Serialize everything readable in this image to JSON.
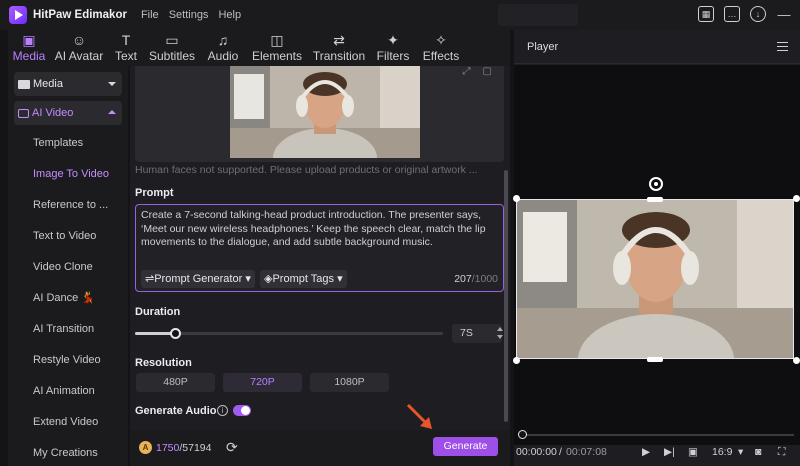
{
  "titlebar": {
    "app_name": "HitPaw Edimakor",
    "menus": [
      "File",
      "Settings",
      "Help"
    ]
  },
  "toolbar": {
    "tools": [
      {
        "label": "Media",
        "icon": "media-icon"
      },
      {
        "label": "AI Avatar",
        "icon": "avatar-icon"
      },
      {
        "label": "Text",
        "icon": "text-icon"
      },
      {
        "label": "Subtitles",
        "icon": "subtitles-icon"
      },
      {
        "label": "Audio",
        "icon": "audio-icon"
      },
      {
        "label": "Elements",
        "icon": "elements-icon"
      },
      {
        "label": "Transition",
        "icon": "transition-icon"
      },
      {
        "label": "Filters",
        "icon": "filters-icon"
      },
      {
        "label": "Effects",
        "icon": "effects-icon"
      }
    ],
    "active": "Media"
  },
  "sidebar": {
    "media_label": "Media",
    "ai_video_label": "AI Video",
    "items": [
      {
        "label": "Templates"
      },
      {
        "label": "Image To Video"
      },
      {
        "label": "Reference to ..."
      },
      {
        "label": "Text to Video"
      },
      {
        "label": "Video Clone"
      },
      {
        "label": "AI Dance 💃"
      },
      {
        "label": "AI Transition"
      },
      {
        "label": "Restyle Video"
      },
      {
        "label": "AI Animation"
      },
      {
        "label": "Extend Video"
      },
      {
        "label": "My Creations"
      }
    ],
    "selected": "Image To Video"
  },
  "panel": {
    "hint": "Human faces not supported. Please upload products or original artwork ...",
    "prompt_label": "Prompt",
    "prompt_text": "Create a 7-second talking-head product introduction. The presenter says, ‘Meet our new wireless headphones.’ Keep the speech clear, match the lip movements to the dialogue, and add subtle background music.",
    "prompt_generator": "Prompt Generator",
    "prompt_tags": "Prompt Tags",
    "char_count": "207",
    "char_max": "/1000",
    "duration_label": "Duration",
    "duration_value": "7S",
    "duration_fraction": 0.13,
    "resolution_label": "Resolution",
    "resolutions": [
      "480P",
      "720P",
      "1080P"
    ],
    "resolution_selected": "720P",
    "generate_audio_label": "Generate Audio",
    "generate_audio_on": true,
    "credits_used": "1750",
    "credits_total": "/57194",
    "generate_button": "Generate"
  },
  "player": {
    "title": "Player",
    "time_current": "00:00:00",
    "time_sep": "/",
    "time_total": "00:07:08",
    "aspect": "16:9",
    "playhead_fraction": 0
  },
  "colors": {
    "accent": "#9d4fe8",
    "accent_text": "#c58cff",
    "background": "#141416"
  }
}
